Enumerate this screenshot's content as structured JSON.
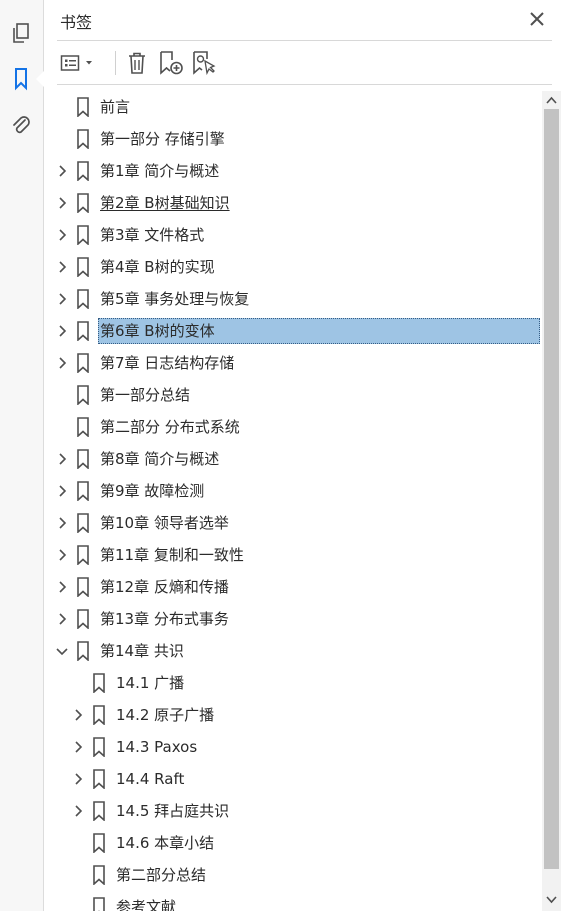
{
  "sidebar": {
    "icons": [
      "pages-icon",
      "bookmark-icon",
      "attachment-icon"
    ],
    "active": "bookmark-icon"
  },
  "panel": {
    "title": "书签",
    "toolbar": [
      "options-menu-icon",
      "delete-bookmark-icon",
      "new-bookmark-icon",
      "find-bookmark-icon"
    ]
  },
  "bookmarks": [
    {
      "label": "前言",
      "level": 0,
      "expander": "none"
    },
    {
      "label": "第一部分 存储引擎",
      "level": 0,
      "expander": "none"
    },
    {
      "label": "第1章 简介与概述",
      "level": 0,
      "expander": "collapsed"
    },
    {
      "label": "第2章 B树基础知识",
      "level": 0,
      "expander": "collapsed",
      "underlined": true
    },
    {
      "label": "第3章 文件格式",
      "level": 0,
      "expander": "collapsed"
    },
    {
      "label": "第4章 B树的实现",
      "level": 0,
      "expander": "collapsed"
    },
    {
      "label": "第5章 事务处理与恢复",
      "level": 0,
      "expander": "collapsed"
    },
    {
      "label": "第6章 B树的变体",
      "level": 0,
      "expander": "collapsed",
      "selected": true
    },
    {
      "label": "第7章 日志结构存储",
      "level": 0,
      "expander": "collapsed"
    },
    {
      "label": "第一部分总结",
      "level": 0,
      "expander": "none"
    },
    {
      "label": "第二部分 分布式系统",
      "level": 0,
      "expander": "none"
    },
    {
      "label": "第8章 简介与概述",
      "level": 0,
      "expander": "collapsed"
    },
    {
      "label": "第9章 故障检测",
      "level": 0,
      "expander": "collapsed"
    },
    {
      "label": "第10章 领导者选举",
      "level": 0,
      "expander": "collapsed"
    },
    {
      "label": "第11章 复制和一致性",
      "level": 0,
      "expander": "collapsed"
    },
    {
      "label": "第12章 反熵和传播",
      "level": 0,
      "expander": "collapsed"
    },
    {
      "label": "第13章 分布式事务",
      "level": 0,
      "expander": "collapsed"
    },
    {
      "label": "第14章 共识",
      "level": 0,
      "expander": "expanded"
    },
    {
      "label": "14.1 广播",
      "level": 1,
      "expander": "none"
    },
    {
      "label": "14.2 原子广播",
      "level": 1,
      "expander": "collapsed"
    },
    {
      "label": "14.3 Paxos",
      "level": 1,
      "expander": "collapsed"
    },
    {
      "label": "14.4 Raft",
      "level": 1,
      "expander": "collapsed"
    },
    {
      "label": "14.5 拜占庭共识",
      "level": 1,
      "expander": "collapsed"
    },
    {
      "label": "14.6 本章小结",
      "level": 1,
      "expander": "none"
    },
    {
      "label": "第二部分总结",
      "level": 1,
      "expander": "none"
    },
    {
      "label": "参考文献",
      "level": 1,
      "expander": "none"
    }
  ],
  "colors": {
    "selection": "#9ec4e4",
    "accent": "#1473e6",
    "icon": "#505050"
  }
}
